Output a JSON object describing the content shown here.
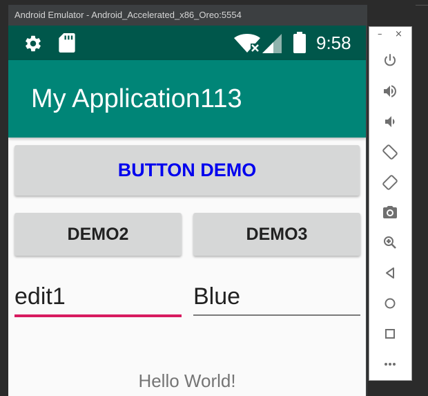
{
  "window": {
    "title": "Android Emulator - Android_Accelerated_x86_Oreo:5554"
  },
  "status_bar": {
    "time": "9:58"
  },
  "app_bar": {
    "title": "My Application113"
  },
  "buttons": {
    "main_label": "BUTTON DEMO",
    "demo2_label": "DEMO2",
    "demo3_label": "DEMO3"
  },
  "fields": {
    "edit1_value": "edit1",
    "edit2_value": "Blue"
  },
  "content": {
    "hello_text": "Hello World!"
  },
  "toolbar": {
    "minimize": "–",
    "close": "×",
    "items": [
      "power-icon",
      "volume-up-icon",
      "volume-down-icon",
      "rotate-left-icon",
      "rotate-right-icon",
      "camera-icon",
      "zoom-icon",
      "back-icon",
      "home-icon",
      "overview-icon",
      "more-icon"
    ]
  },
  "colors": {
    "status_bar": "#00574b",
    "app_bar": "#008577",
    "accent_underline": "#d81b60",
    "main_button_text": "#0000ee"
  }
}
